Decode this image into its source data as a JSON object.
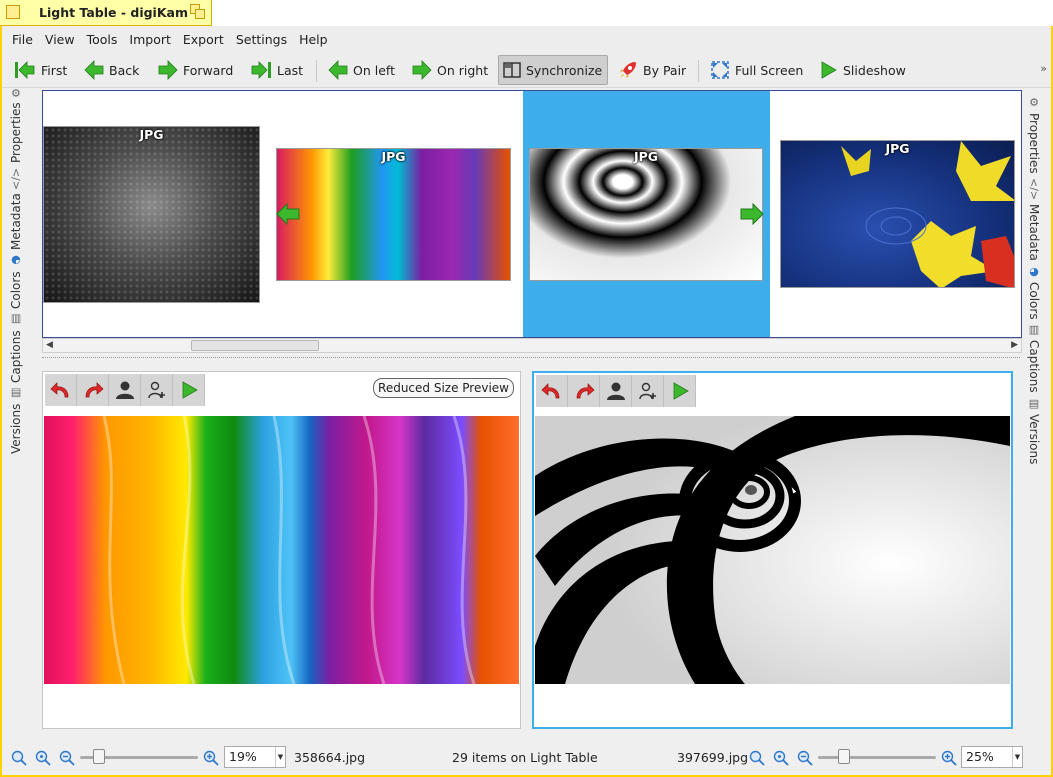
{
  "window": {
    "title": "Light Table - digiKam"
  },
  "menu": [
    "File",
    "View",
    "Tools",
    "Import",
    "Export",
    "Settings",
    "Help"
  ],
  "toolbar": {
    "first": "First",
    "back": "Back",
    "forward": "Forward",
    "last": "Last",
    "on_left": "On left",
    "on_right": "On right",
    "synchronize": "Synchronize",
    "by_pair": "By Pair",
    "full_screen": "Full Screen",
    "slideshow": "Slideshow",
    "more": "»"
  },
  "left_sidebar": [
    "Properties",
    "Metadata",
    "Colors",
    "Captions",
    "Versions"
  ],
  "right_sidebar": [
    "Properties",
    "Metadata",
    "Colors",
    "Captions",
    "Versions"
  ],
  "thumbnails": [
    {
      "label": "JPG",
      "selected": false
    },
    {
      "label": "JPG",
      "selected": false
    },
    {
      "label": "JPG",
      "selected": true
    },
    {
      "label": "JPG",
      "selected": false
    }
  ],
  "left_pane": {
    "preview_mode": "Reduced Size Preview",
    "file": "358664.jpg",
    "zoom": "19%"
  },
  "right_pane": {
    "file": "397699.jpg",
    "zoom": "25%"
  },
  "status": {
    "items": "29 items on Light Table"
  },
  "colors": {
    "accent": "#3daee9",
    "title_bg": "#ffffa8",
    "frame": "#ffd200",
    "green_arrow": "#3cb82c"
  }
}
